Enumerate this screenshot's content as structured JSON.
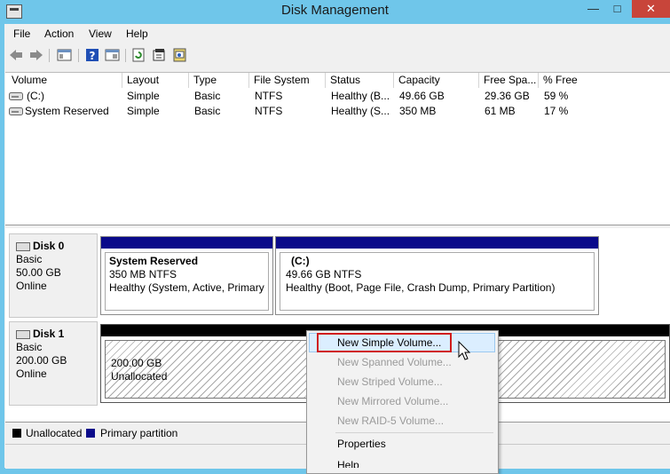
{
  "window": {
    "title": "Disk Management"
  },
  "menu": [
    "File",
    "Action",
    "View",
    "Help"
  ],
  "toolbar": {
    "icons": [
      "back-icon",
      "forward-icon",
      "console-tree-icon",
      "help-icon",
      "show-hide-icon",
      "refresh-icon",
      "properties-icon",
      "rescan-icon"
    ]
  },
  "volumes": {
    "columns": [
      "Volume",
      "Layout",
      "Type",
      "File System",
      "Status",
      "Capacity",
      "Free Spa...",
      "% Free"
    ],
    "rows": [
      [
        "(C:)",
        "Simple",
        "Basic",
        "NTFS",
        "Healthy (B...",
        "49.66 GB",
        "29.36 GB",
        "59 %"
      ],
      [
        "System Reserved",
        "Simple",
        "Basic",
        "NTFS",
        "Healthy (S...",
        "350 MB",
        "61 MB",
        "17 %"
      ]
    ]
  },
  "disks": [
    {
      "name": "Disk 0",
      "type": "Basic",
      "size": "50.00 GB",
      "state": "Online",
      "partitions": [
        {
          "title": "System Reserved",
          "detail": "350 MB NTFS",
          "status": "Healthy (System, Active, Primary P"
        },
        {
          "title": "(C:)",
          "detail": "49.66 GB NTFS",
          "status": "Healthy (Boot, Page File, Crash Dump, Primary Partition)"
        }
      ]
    },
    {
      "name": "Disk 1",
      "type": "Basic",
      "size": "200.00 GB",
      "state": "Online",
      "partitions": [
        {
          "title": "200.00 GB",
          "detail": "Unallocated"
        }
      ]
    }
  ],
  "legend": [
    {
      "label": "Unallocated",
      "color": "#000000"
    },
    {
      "label": "Primary partition",
      "color": "#0a0a8a"
    }
  ],
  "context_menu": {
    "items": [
      {
        "label": "New Simple Volume...",
        "enabled": true
      },
      {
        "label": "New Spanned Volume...",
        "enabled": false
      },
      {
        "label": "New Striped Volume...",
        "enabled": false
      },
      {
        "label": "New Mirrored Volume...",
        "enabled": false
      },
      {
        "label": "New RAID-5 Volume...",
        "enabled": false
      },
      {
        "label": "Properties",
        "enabled": true
      },
      {
        "label": "Help",
        "enabled": true
      }
    ]
  },
  "colors": {
    "titlebar": "#6fc6ea",
    "primary_partition": "#0a0a8a",
    "highlight_box": "#d01c1c"
  }
}
